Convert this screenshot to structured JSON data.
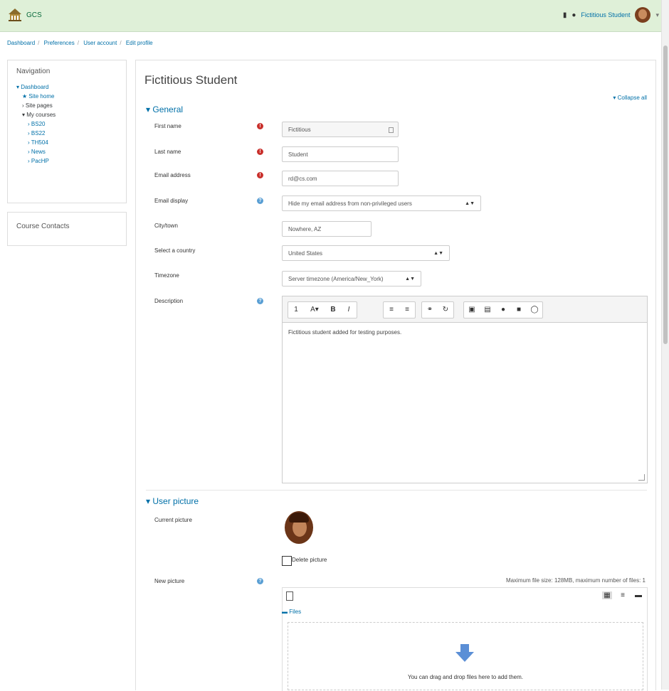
{
  "header": {
    "site_name": "GCS",
    "user_name": "Fictitious Student",
    "colors": {
      "bar": "#dff0d8",
      "link": "#0070a8",
      "required": "#c9302c",
      "help": "#5a9fd4"
    }
  },
  "breadcrumb": [
    "Dashboard",
    "Preferences",
    "User account",
    "Edit profile"
  ],
  "navigation": {
    "title": "Navigation",
    "items": [
      {
        "label": "Dashboard",
        "prefix": "▾"
      },
      {
        "label": "Site home",
        "prefix": "★"
      },
      {
        "label": "Site pages",
        "prefix": "›"
      },
      {
        "label": "My courses",
        "prefix": "▾"
      },
      {
        "label": "BS20",
        "prefix": "›"
      },
      {
        "label": "BS22",
        "prefix": "›"
      },
      {
        "label": "TH504",
        "prefix": "›"
      },
      {
        "label": "News",
        "prefix": "›"
      },
      {
        "label": "PacHP",
        "prefix": "›"
      }
    ]
  },
  "course_contacts": {
    "title": "Course Contacts"
  },
  "main": {
    "title": "Fictitious Student",
    "collapse_all": "▾ Collapse all",
    "general": {
      "title": "General",
      "first_name": {
        "label": "First name",
        "value": "Fictitious"
      },
      "last_name": {
        "label": "Last name",
        "value": "Student"
      },
      "email": {
        "label": "Email address",
        "value": "rd@cs.com"
      },
      "email_display": {
        "label": "Email display",
        "value": "Hide my email address from non-privileged users"
      },
      "city": {
        "label": "City/town",
        "value": "Nowhere, AZ"
      },
      "country": {
        "label": "Select a country",
        "value": "United States"
      },
      "timezone": {
        "label": "Timezone",
        "value": "Server timezone (America/New_York)"
      },
      "description": {
        "label": "Description",
        "value": "Fictitious student added for testing purposes."
      }
    },
    "user_picture": {
      "title": "User picture",
      "current_label": "Current picture",
      "delete_label": "Delete picture",
      "new_label": "New picture",
      "limits": "Maximum file size: 128MB, maximum number of files: 1",
      "files_path": "Files",
      "drop_text": "You can drag and drop files here to add them."
    }
  }
}
